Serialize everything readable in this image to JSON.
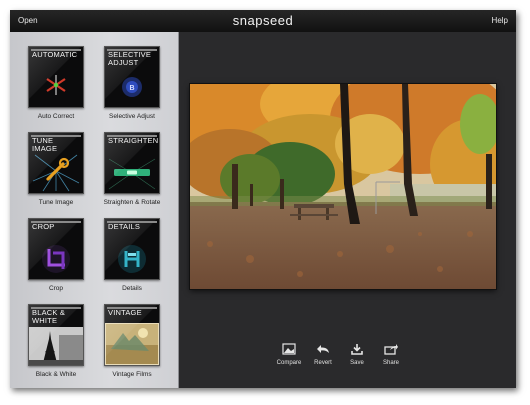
{
  "topbar": {
    "open_label": "Open",
    "logo": "snapseed",
    "help_label": "Help"
  },
  "tools": [
    {
      "tile_title": "AUTOMATIC",
      "label": "Auto Correct",
      "icon": "auto-correct-icon"
    },
    {
      "tile_title": "SELECTIVE ADJUST",
      "label": "Selective Adjust",
      "icon": "selective-adjust-icon"
    },
    {
      "tile_title": "TUNE IMAGE",
      "label": "Tune Image",
      "icon": "wrench-icon"
    },
    {
      "tile_title": "STRAIGHTEN",
      "label": "Straighten & Rotate",
      "icon": "level-icon"
    },
    {
      "tile_title": "CROP",
      "label": "Crop",
      "icon": "crop-icon"
    },
    {
      "tile_title": "DETAILS",
      "label": "Details",
      "icon": "details-icon"
    },
    {
      "tile_title": "BLACK & WHITE",
      "label": "Black & White",
      "icon": "eiffel-tower-icon"
    },
    {
      "tile_title": "VINTAGE",
      "label": "Vintage Films",
      "icon": "vintage-photo-icon"
    }
  ],
  "photo": {
    "subject": "autumn-park-photo"
  },
  "actions": [
    {
      "label": "Compare",
      "icon": "compare-icon"
    },
    {
      "label": "Revert",
      "icon": "revert-icon"
    },
    {
      "label": "Save",
      "icon": "save-icon"
    },
    {
      "label": "Share",
      "icon": "share-icon"
    }
  ],
  "colors": {
    "topbar": "#1a1a1a",
    "sidebar": "#d3d4d8",
    "canvas": "#2a2a2c",
    "tile_bg": "#0b0b0c"
  }
}
